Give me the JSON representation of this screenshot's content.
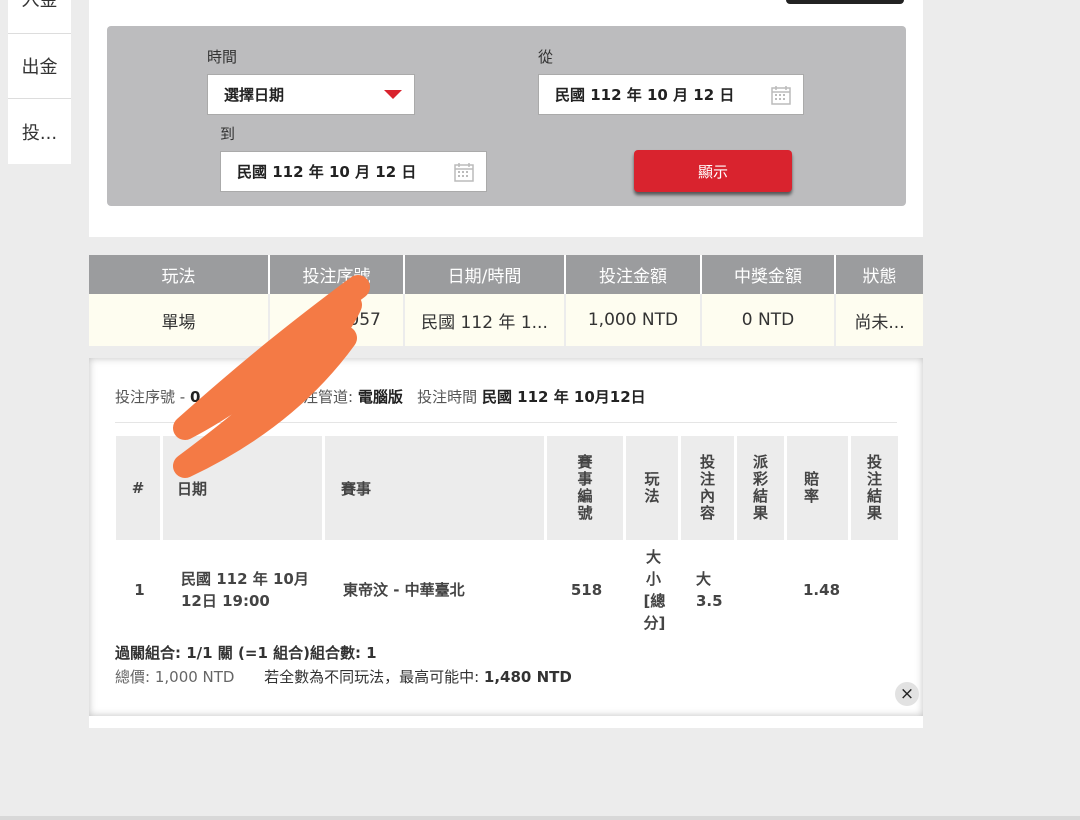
{
  "sidebar": {
    "items": [
      {
        "label": "入金"
      },
      {
        "label": "出金"
      },
      {
        "label": "投..."
      }
    ]
  },
  "filter": {
    "time_label": "時間",
    "time_select": "選擇日期",
    "from_label": "從",
    "from_date": "民國 112 年 10 月 12 日",
    "to_label": "到",
    "to_date": "民國 112 年 10 月 12 日",
    "show_button": "顯示"
  },
  "results": {
    "headers": [
      "玩法",
      "投注序號",
      "日期/時間",
      "投注金額",
      "中獎金額",
      "狀態"
    ],
    "row": [
      "單場",
      "0    057",
      "民國 112 年 1...",
      "1,000 NTD",
      "0 NTD",
      "尚未..."
    ]
  },
  "detail": {
    "meta": {
      "serial_label": "投注序號 -",
      "serial_value": "0",
      "channel_label": "投注管道:",
      "channel_value": "電腦版",
      "time_label": "投注時間",
      "time_value": "民國 112 年 10月12日"
    },
    "headers": [
      "#",
      "日期",
      "賽事",
      "賽事編號",
      "玩法",
      "投注內容",
      "派彩結果",
      "賠率",
      "投注結果"
    ],
    "row": {
      "index": "1",
      "date_line1": "民國 112 年 10月",
      "date_line2": "12日 19:00",
      "event": "東帝汶 - 中華臺北",
      "event_no": "518",
      "play": "大小[總分]",
      "bet_line1": "大",
      "bet_line2": "3.5",
      "payout": "",
      "odds": "1.48",
      "result": ""
    },
    "combo": "過關組合: 1/1 關 (=1 組合)組合數: 1",
    "total_label": "總價:",
    "total_value": "1,000 NTD",
    "max_label": "若全數為不同玩法，最高可能中:",
    "max_value": "1,480 NTD",
    "close": "×"
  },
  "colors": {
    "accent_red": "#d9232e",
    "header_gray": "#9b9c9e",
    "filter_bg": "#bcbcbe",
    "row_bg": "#fefdf0",
    "scribble": "#f47a45"
  }
}
